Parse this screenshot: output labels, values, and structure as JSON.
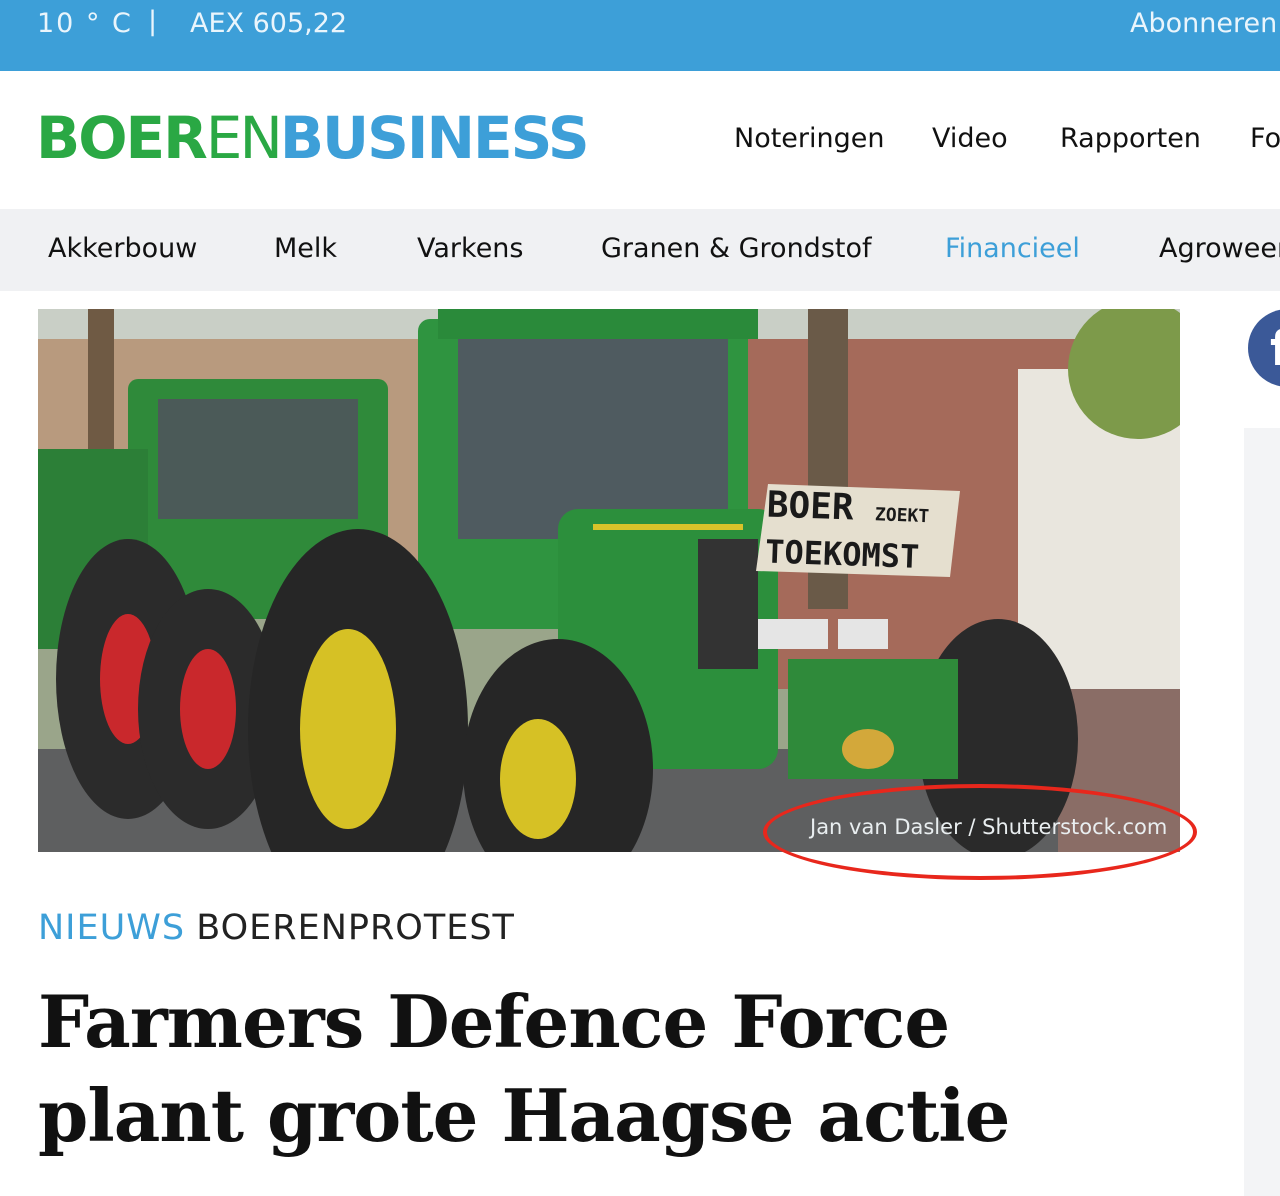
{
  "topbar": {
    "weather": "10 ° C",
    "separator": "|",
    "aex": "AEX 605,22",
    "subscribe": "Abonneren"
  },
  "logo": {
    "part1": "BOER",
    "part2": "EN",
    "part3": "BUSINESS"
  },
  "main_nav": [
    "Noteringen",
    "Video",
    "Rapporten",
    "Fo"
  ],
  "sub_nav": [
    "Akkerbouw",
    "Melk",
    "Varkens",
    "Granen & Grondstof",
    "Financieel",
    "Agroweer"
  ],
  "sub_nav_active": "Financieel",
  "hero": {
    "sign_line1": "BOER",
    "sign_line1_small": "ZOEKT",
    "sign_line2": "TOEKOMST",
    "credit": "Jan van Dasler / Shutterstock.com"
  },
  "article": {
    "category": "NIEUWS",
    "tag": "BOERENPROTEST",
    "title_line1": "Farmers Defence Force",
    "title_line2": "plant grote Haagse actie"
  },
  "social": {
    "icon": "facebook-icon",
    "glyph": "f"
  },
  "colors": {
    "brand_blue": "#3d9fd8",
    "brand_green": "#2aa844",
    "annotation_red": "#e8271c"
  }
}
